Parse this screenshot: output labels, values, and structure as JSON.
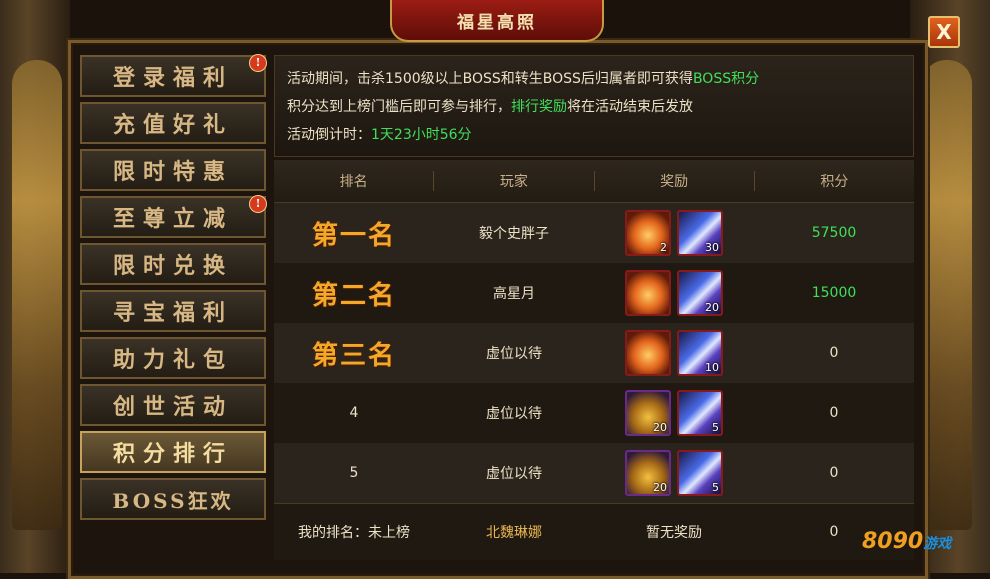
{
  "window": {
    "title": "福星高照",
    "close_label": "X"
  },
  "sidebar": {
    "items": [
      {
        "label": "登录福利",
        "badge": "!"
      },
      {
        "label": "充值好礼",
        "badge": ""
      },
      {
        "label": "限时特惠",
        "badge": ""
      },
      {
        "label": "至尊立减",
        "badge": "!"
      },
      {
        "label": "限时兑换",
        "badge": ""
      },
      {
        "label": "寻宝福利",
        "badge": ""
      },
      {
        "label": "助力礼包",
        "badge": ""
      },
      {
        "label": "创世活动",
        "badge": ""
      },
      {
        "label": "积分排行",
        "badge": ""
      },
      {
        "label": "BOSS狂欢",
        "badge": ""
      }
    ],
    "active_index": 8
  },
  "info": {
    "line1_prefix": "活动期间，击杀1500级以上BOSS和转生BOSS后归属者即可获得",
    "line1_highlight": "BOSS积分",
    "line2_prefix": "积分达到上榜门槛后即可参与排行，",
    "line2_highlight": "排行奖励",
    "line2_suffix": "将在活动结束后发放",
    "countdown_label": "活动倒计时：",
    "countdown_value": "1天23小时56分"
  },
  "table": {
    "headers": {
      "rank": "排名",
      "player": "玩家",
      "reward": "奖励",
      "score": "积分"
    },
    "rows": [
      {
        "rank": "第一名",
        "player": "毅个史胖子",
        "rewards": [
          {
            "icon": "potion-icon",
            "qty": "2"
          },
          {
            "icon": "crystal-icon",
            "qty": "30"
          }
        ],
        "score": "57500"
      },
      {
        "rank": "第二名",
        "player": "高星月",
        "rewards": [
          {
            "icon": "potion-icon",
            "qty": ""
          },
          {
            "icon": "crystal-icon",
            "qty": "20"
          }
        ],
        "score": "15000"
      },
      {
        "rank": "第三名",
        "player": "虚位以待",
        "rewards": [
          {
            "icon": "potion-icon",
            "qty": ""
          },
          {
            "icon": "crystal-icon",
            "qty": "10"
          }
        ],
        "score": "0"
      },
      {
        "rank": "4",
        "player": "虚位以待",
        "rewards": [
          {
            "icon": "chest-icon",
            "qty": "20"
          },
          {
            "icon": "crystal-icon",
            "qty": "5"
          }
        ],
        "score": "0"
      },
      {
        "rank": "5",
        "player": "虚位以待",
        "rewards": [
          {
            "icon": "chest-icon",
            "qty": "20"
          },
          {
            "icon": "crystal-icon",
            "qty": "5"
          }
        ],
        "score": "0"
      }
    ]
  },
  "my_rank": {
    "label": "我的排名：未上榜",
    "player": "北魏琳娜",
    "reward": "暂无奖励",
    "score": "0"
  },
  "watermark": {
    "text": "8090",
    "sub": "游戏"
  },
  "colors": {
    "highlight_green": "#3fe05a",
    "rank_gold": "#f4a82a",
    "accent_red": "#9c1d14"
  }
}
